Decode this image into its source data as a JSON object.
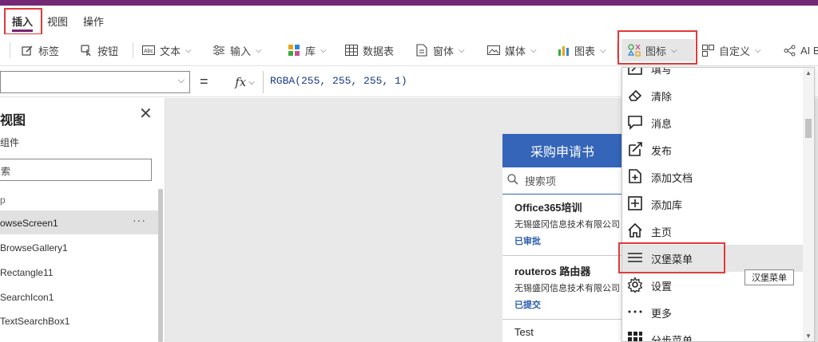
{
  "menu": {
    "tabs": [
      "插入",
      "视图",
      "操作"
    ]
  },
  "toolbar": {
    "label": "标签",
    "button": "按钮",
    "text": "文本",
    "input": "输入",
    "library": "库",
    "datatable": "数据表",
    "form": "窗体",
    "media": "媒体",
    "chart": "图表",
    "icons": "图标",
    "custom": "自定义",
    "ai": "AI B"
  },
  "formula": {
    "fx": "fx",
    "eq": "=",
    "expression": "RGBA(255, 255, 255, 1)"
  },
  "treeview": {
    "title": "视图",
    "components_tab": "组件",
    "search_placeholder": "索",
    "app_label": "p",
    "items": [
      "owseScreen1",
      "BrowseGallery1",
      "Rectangle11",
      "SearchIcon1",
      "TextSearchBox1"
    ]
  },
  "app": {
    "title": "采购申请书",
    "search_placeholder": "搜索项",
    "cards": [
      {
        "title": "Office365培训",
        "company": "无锡盛冈信息技术有限公司",
        "status": "已审批"
      },
      {
        "title": "routeros 路由器",
        "company": "无锡盛冈信息技术有限公司",
        "status": "已提交"
      },
      {
        "title": "Test",
        "company": "",
        "status": ""
      }
    ]
  },
  "dropdown": {
    "items": [
      "填写",
      "清除",
      "消息",
      "发布",
      "添加文档",
      "添加库",
      "主页",
      "汉堡菜单",
      "设置",
      "更多",
      "分步菜单"
    ],
    "highlighted": "汉堡菜单"
  },
  "tooltip": "汉堡菜单",
  "colors": {
    "brand": "#742774",
    "accent": "#3565b8",
    "highlight_box": "#e03a3a"
  }
}
